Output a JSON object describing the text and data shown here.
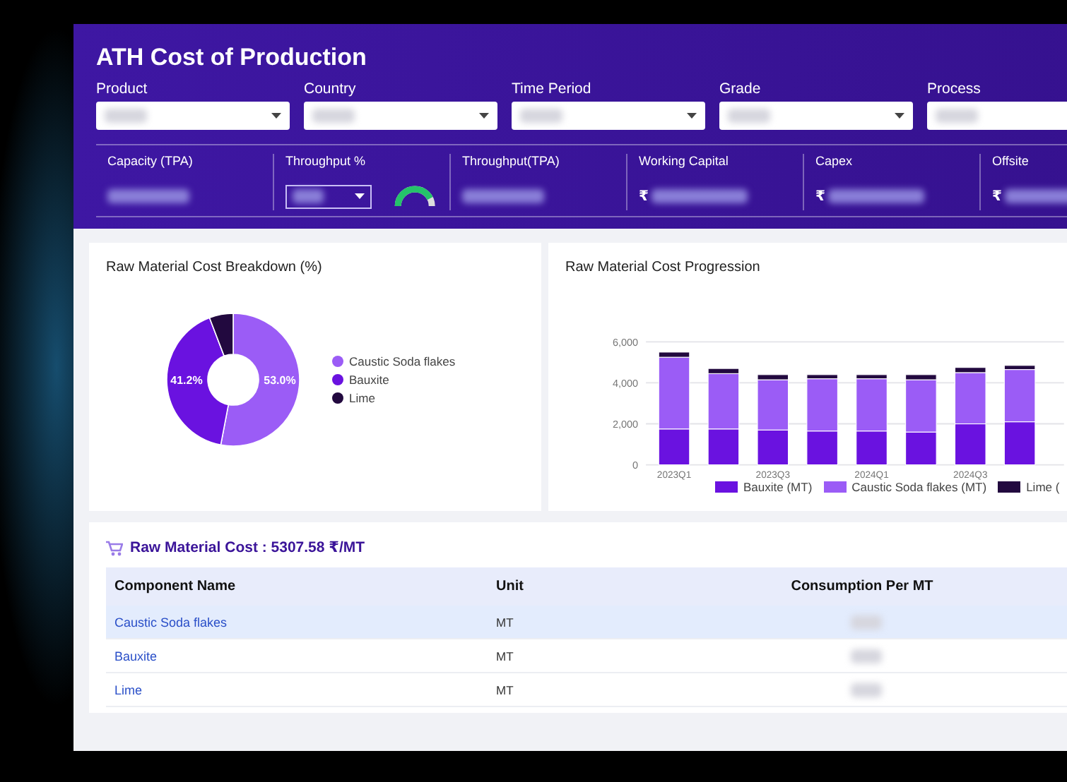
{
  "title": "ATH Cost of Production",
  "filters": [
    {
      "label": "Product"
    },
    {
      "label": "Country"
    },
    {
      "label": "Time Period"
    },
    {
      "label": "Grade"
    },
    {
      "label": "Process"
    }
  ],
  "metrics": [
    {
      "label": "Capacity (TPA)",
      "kind": "value"
    },
    {
      "label": "Throughput %",
      "kind": "select",
      "gauge": {
        "level": 0.85
      }
    },
    {
      "label": "Throughput(TPA)",
      "kind": "value"
    },
    {
      "label": "Working Capital",
      "kind": "currency",
      "currency": "₹"
    },
    {
      "label": "Capex",
      "kind": "currency",
      "currency": "₹"
    },
    {
      "label": "Offsite",
      "kind": "currency",
      "currency": "₹"
    }
  ],
  "breakdown": {
    "title": "Raw Material Cost Breakdown (%)",
    "chart_data": {
      "type": "donut",
      "categories": [
        "Caustic Soda flakes",
        "Bauxite",
        "Lime"
      ],
      "colors": [
        "#9b5cf6",
        "#6a12e0",
        "#22093f"
      ],
      "values": [
        53.0,
        41.2,
        5.8
      ],
      "value_labels": [
        "53.0%",
        "41.2%",
        null
      ]
    }
  },
  "progression": {
    "title": "Raw Material Cost Progression",
    "chart_data": {
      "type": "bar",
      "stacked": true,
      "categories": [
        "2023Q1",
        null,
        "2023Q3",
        null,
        "2024Q1",
        null,
        "2024Q3",
        null
      ],
      "ylim": [
        0,
        6000
      ],
      "yticks": [
        {
          "value": 0,
          "label": "0"
        },
        {
          "value": 2000,
          "label": "2,000"
        },
        {
          "value": 4000,
          "label": "4,000"
        },
        {
          "value": 6000,
          "label": "6,000"
        }
      ],
      "series": [
        {
          "name": "Bauxite (MT)",
          "color": "#6a12e0",
          "values": [
            1750,
            1750,
            1700,
            1650,
            1650,
            1600,
            2000,
            2100
          ]
        },
        {
          "name": "Caustic Soda flakes (MT)",
          "color": "#9b5cf6",
          "values": [
            3500,
            2700,
            2450,
            2550,
            2550,
            2550,
            2500,
            2550
          ]
        },
        {
          "name": "Lime (",
          "color": "#22093f",
          "values": [
            250,
            250,
            250,
            200,
            200,
            250,
            250,
            200
          ]
        }
      ]
    }
  },
  "cost_table": {
    "heading": "Raw Material Cost : 5307.58 ₹/MT",
    "columns": [
      "Component Name",
      "Unit",
      "Consumption Per MT"
    ],
    "rows": [
      {
        "name": "Caustic Soda flakes",
        "unit": "MT",
        "selected": true
      },
      {
        "name": "Bauxite",
        "unit": "MT",
        "selected": false
      },
      {
        "name": "Lime",
        "unit": "MT",
        "selected": false
      }
    ]
  }
}
